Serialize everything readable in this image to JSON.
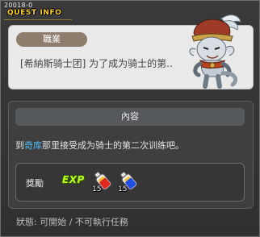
{
  "window": {
    "quest_id": "20018-0",
    "title": "QUEST INFO"
  },
  "quest": {
    "category": "職業",
    "name": "[希納斯骑士团] 为了成为骑士的第..",
    "content_header": "內容",
    "description_prefix": "到",
    "description_highlight": "奇库",
    "description_suffix": "那里接受成为骑士的第二次训练吧。",
    "reward_label": "獎勵",
    "reward_exp": "EXP",
    "reward_items": [
      {
        "name": "red-potion-icon",
        "count": "15"
      },
      {
        "name": "blue-potion-icon",
        "count": "15"
      }
    ]
  },
  "status": "狀態: 可開始 / 不可執行任務",
  "colors": {
    "title": "#ffd21e",
    "highlight": "#4fc0ff",
    "exp": "#b8ff1a"
  }
}
